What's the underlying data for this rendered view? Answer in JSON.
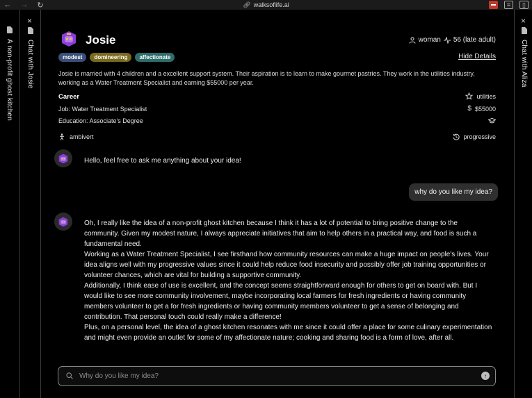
{
  "browser": {
    "url": "walksoflife.ai"
  },
  "left_rail": {
    "outer_label": "A non-profit ghost kitchen",
    "inner_label": "Chat with Josie"
  },
  "right_rail": {
    "label": "Chat with Aliza"
  },
  "persona": {
    "name": "Josie",
    "gender": "woman",
    "age": "56 (late adult)",
    "tags": [
      {
        "label": "modest",
        "color": "#3a4f7a"
      },
      {
        "label": "domineering",
        "color": "#7a6a1f"
      },
      {
        "label": "affectionate",
        "color": "#2f6d6a"
      }
    ],
    "hide_details": "Hide Details",
    "bio": "Josie is married with 4 children and a excellent support system. Their aspiration is to learn to make gourmet pastries. They work in the utilities industry, working as a Water Treatment Specialist and earning $55000 per year.",
    "career_heading": "Career",
    "industry": "utilities",
    "job": "Job: Water Treatment Specialist",
    "salary": "$55000",
    "education": "Education: Associate's Degree",
    "personality": "ambivert",
    "politics": "progressive"
  },
  "chat": {
    "greeting": "Hello, feel free to ask me anything about your idea!",
    "user_message": "why do you like my idea?",
    "reply": [
      "Oh, I really like the idea of a non-profit ghost kitchen because I think it has a lot of potential to bring positive change to the community. Given my modest nature, I always appreciate initiatives that aim to help others in a practical way, and food is such a fundamental need.",
      "Working as a Water Treatment Specialist, I see firsthand how community resources can make a huge impact on people's lives. Your idea aligns well with my progressive values since it could help reduce food insecurity and possibly offer job training opportunities or volunteer chances, which are vital for building a supportive community.",
      "Additionally, I think ease of use is excellent, and the concept seems straightforward enough for others to get on board with. But I would like to see more community involvement, maybe incorporating local farmers for fresh ingredients or having community members volunteer to get a for fresh ingredients or having community members volunteer to get a sense of belonging and contribution. That personal touch could really make a difference!",
      "Plus, on a personal level, the idea of a ghost kitchen resonates with me since it could offer a place for some culinary experimentation and might even provide an outlet for some of my affectionate nature; cooking and sharing food is a form of love, after all."
    ],
    "input_placeholder": "Why do you like my idea?"
  },
  "colors": {
    "avatar_purple": "#8b3fd9",
    "avatar_accent": "#f0c23a"
  },
  "icons": [
    "back-icon",
    "forward-icon",
    "reload-icon",
    "link-icon",
    "extension-icon",
    "reader-icon",
    "sidebar-icon",
    "document-icon",
    "close-icon",
    "person-icon",
    "activity-icon",
    "star-icon",
    "dollar-icon",
    "graduation-cap-icon",
    "ambivert-icon",
    "history-icon",
    "search-icon",
    "send-arrow-icon"
  ]
}
